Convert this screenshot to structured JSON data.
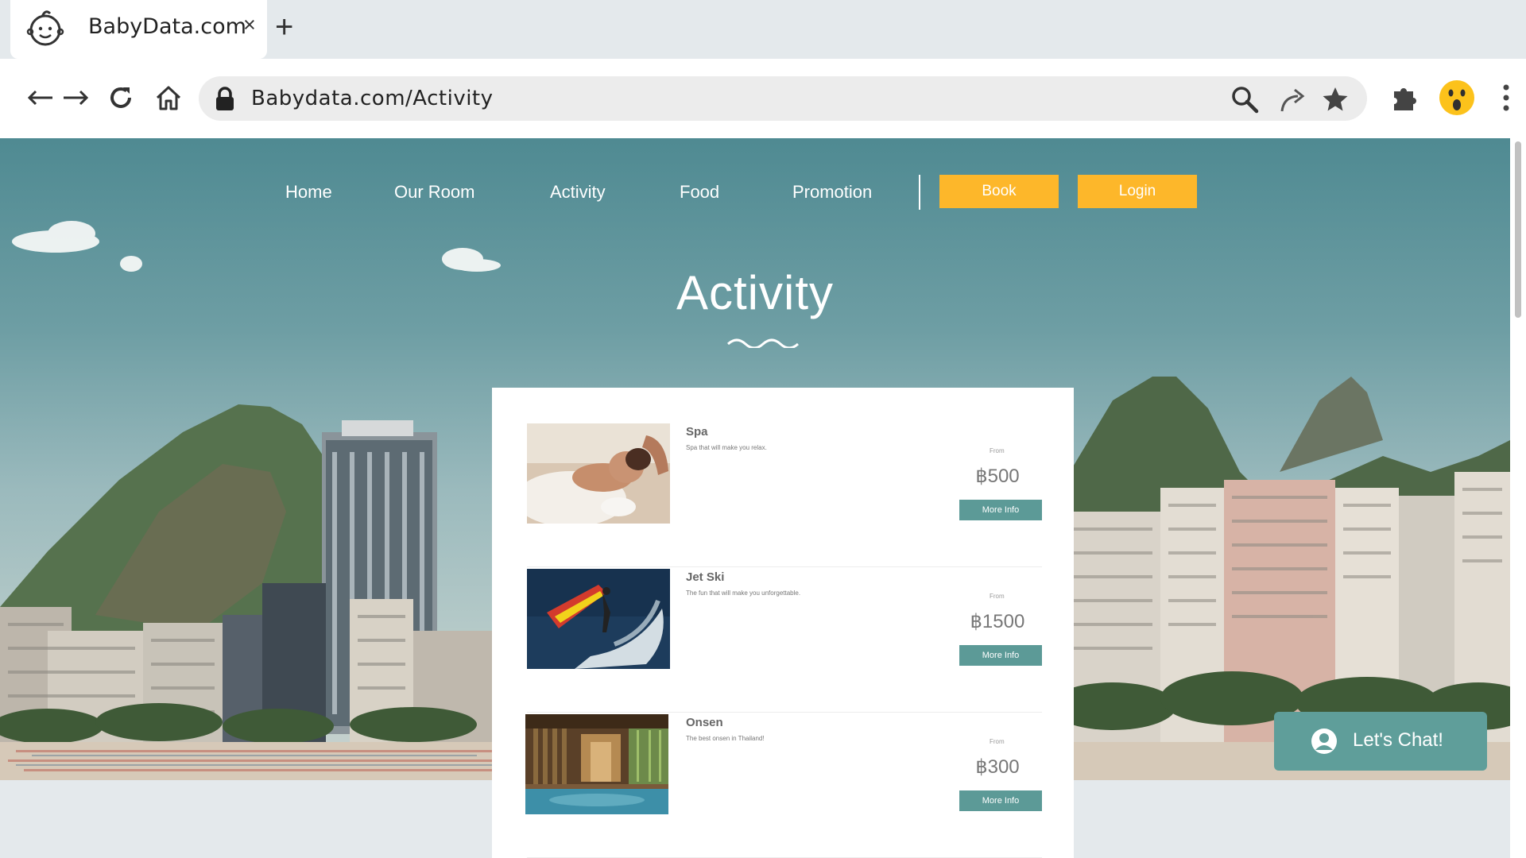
{
  "browser": {
    "tab_title": "BabyData.com",
    "tab_close": "×",
    "new_tab": "+",
    "url": "Babydata.com/Activity"
  },
  "site": {
    "nav": [
      "Home",
      "Our Room",
      "Activity",
      "Food",
      "Promotion"
    ],
    "book_label": "Book",
    "login_label": "Login",
    "page_title": "Activity"
  },
  "activities": [
    {
      "name": "Spa",
      "description": "Spa that will make you relax.",
      "from_label": "From",
      "price": "฿500",
      "button": "More Info"
    },
    {
      "name": "Jet Ski",
      "description": "The fun that will make you unforgettable.",
      "from_label": "From",
      "price": "฿1500",
      "button": "More Info"
    },
    {
      "name": "Onsen",
      "description": "The best onsen in Thailand!",
      "from_label": "From",
      "price": "฿300",
      "button": "More Info"
    }
  ],
  "chat": {
    "label": "Let's Chat!"
  },
  "colors": {
    "accent": "#fdb72a",
    "teal": "#5c9a97",
    "chat": "#5f9e9a"
  },
  "icons": [
    "baby-face-icon",
    "back-arrow-icon",
    "forward-arrow-icon",
    "reload-icon",
    "home-icon",
    "lock-icon",
    "search-icon",
    "share-icon",
    "star-icon",
    "extension-icon",
    "profile-avatar-icon",
    "more-menu-icon",
    "user-avatar-icon"
  ]
}
